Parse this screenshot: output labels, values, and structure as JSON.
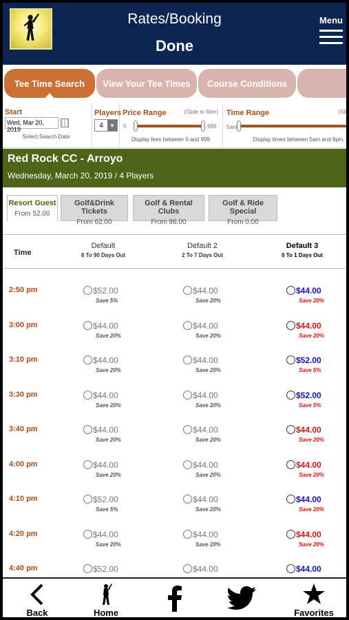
{
  "header": {
    "title": "Rates/Booking",
    "done_label": "Done",
    "menu_label": "Menu"
  },
  "tabs": [
    {
      "label": "Tee Time Search",
      "active": true
    },
    {
      "label": "View Your Tee Times",
      "active": false
    },
    {
      "label": "Course Conditions",
      "active": false
    },
    {
      "label": "",
      "active": false
    }
  ],
  "filters": {
    "start_label": "Start",
    "start_value": "Wed, Mar 20, 2019",
    "start_sub": "Select Search Date",
    "players_label": "Players",
    "players_value": "4",
    "price_label": "Price Range",
    "price_hint": "(Slide to filter)",
    "price_min": "0",
    "price_max": "999",
    "price_sub": "Display fees between 0 and 999.",
    "time_label": "Time Range",
    "time_hint": "(Sli",
    "time_min": "5am",
    "time_sub": "Display times between 5am and 6pm."
  },
  "course": {
    "name": "Red Rock CC - Arroyo",
    "details": "Wednesday, March 20, 2019 / 4 Players"
  },
  "rate_tabs": [
    {
      "name": "Resort Guest",
      "from": "From 52.00",
      "active": true
    },
    {
      "name": "Golf&Drink Tickets",
      "from": "From 62.00",
      "active": false
    },
    {
      "name": "Golf & Rental Clubs",
      "from": "From 86.00",
      "active": false
    },
    {
      "name": "Golf & Ride Special",
      "from": "From 0.00",
      "active": false
    }
  ],
  "table": {
    "time_header": "Time",
    "columns": [
      {
        "name": "Default",
        "range": "8 To 90 Days Out"
      },
      {
        "name": "Default 2",
        "range": "2 To 7 Days Out"
      },
      {
        "name": "Default 3",
        "range": "0 To 1 Days Out"
      }
    ],
    "rows": [
      {
        "time": "2:50 pm",
        "c1": {
          "price": "$52.00",
          "save": "Save 5%"
        },
        "c2": {
          "price": "$44.00",
          "save": "Save 20%"
        },
        "c3": {
          "price": "$44.00",
          "save": "Save 20%",
          "color": "#1010d0"
        }
      },
      {
        "time": "3:00 pm",
        "c1": {
          "price": "$44.00",
          "save": "Save 20%"
        },
        "c2": {
          "price": "$44.00",
          "save": "Save 20%"
        },
        "c3": {
          "price": "$44.00",
          "save": "Save 20%",
          "color": "#e01212"
        }
      },
      {
        "time": "3:10 pm",
        "c1": {
          "price": "$44.00",
          "save": "Save 20%"
        },
        "c2": {
          "price": "$44.00",
          "save": "Save 20%"
        },
        "c3": {
          "price": "$52.00",
          "save": "Save 5%",
          "color": "#1010d0"
        }
      },
      {
        "time": "3:30 pm",
        "c1": {
          "price": "$44.00",
          "save": "Save 20%"
        },
        "c2": {
          "price": "$44.00",
          "save": "Save 20%"
        },
        "c3": {
          "price": "$52.00",
          "save": "Save 5%",
          "color": "#1010d0"
        }
      },
      {
        "time": "3:40 pm",
        "c1": {
          "price": "$44.00",
          "save": "Save 20%"
        },
        "c2": {
          "price": "$44.00",
          "save": "Save 20%"
        },
        "c3": {
          "price": "$44.00",
          "save": "Save 20%",
          "color": "#e01212"
        }
      },
      {
        "time": "4:00 pm",
        "c1": {
          "price": "$44.00",
          "save": "Save 20%"
        },
        "c2": {
          "price": "$44.00",
          "save": "Save 20%"
        },
        "c3": {
          "price": "$44.00",
          "save": "Save 20%",
          "color": "#e01212"
        }
      },
      {
        "time": "4:10 pm",
        "c1": {
          "price": "$52.00",
          "save": "Save 5%"
        },
        "c2": {
          "price": "$44.00",
          "save": "Save 20%"
        },
        "c3": {
          "price": "$44.00",
          "save": "Save 20%",
          "color": "#1010d0"
        }
      },
      {
        "time": "4:20 pm",
        "c1": {
          "price": "$44.00",
          "save": "Save 20%"
        },
        "c2": {
          "price": "$44.00",
          "save": "Save 20%"
        },
        "c3": {
          "price": "$44.00",
          "save": "Save 20%",
          "color": "#e01212"
        }
      },
      {
        "time": "4:40 pm",
        "c1": {
          "price": "$52.00",
          "save": ""
        },
        "c2": {
          "price": "$44.00",
          "save": ""
        },
        "c3": {
          "price": "$44.00",
          "save": "",
          "color": "#1010d0"
        }
      }
    ]
  },
  "bottom_nav": [
    {
      "label": "Back",
      "icon": "chevron-left-icon"
    },
    {
      "label": "Home",
      "icon": "golfer-icon"
    },
    {
      "label": "",
      "icon": "facebook-icon"
    },
    {
      "label": "",
      "icon": "twitter-icon"
    },
    {
      "label": "Favorites",
      "icon": "star-icon"
    }
  ],
  "colors": {
    "header_bg": "#0e2451",
    "tab_active": "#cc7135",
    "tab_inactive": "#d9b3ad",
    "course_bg": "#4d6419",
    "time_text": "#b24a16",
    "price_blue": "#1010d0",
    "price_red": "#e01212"
  }
}
